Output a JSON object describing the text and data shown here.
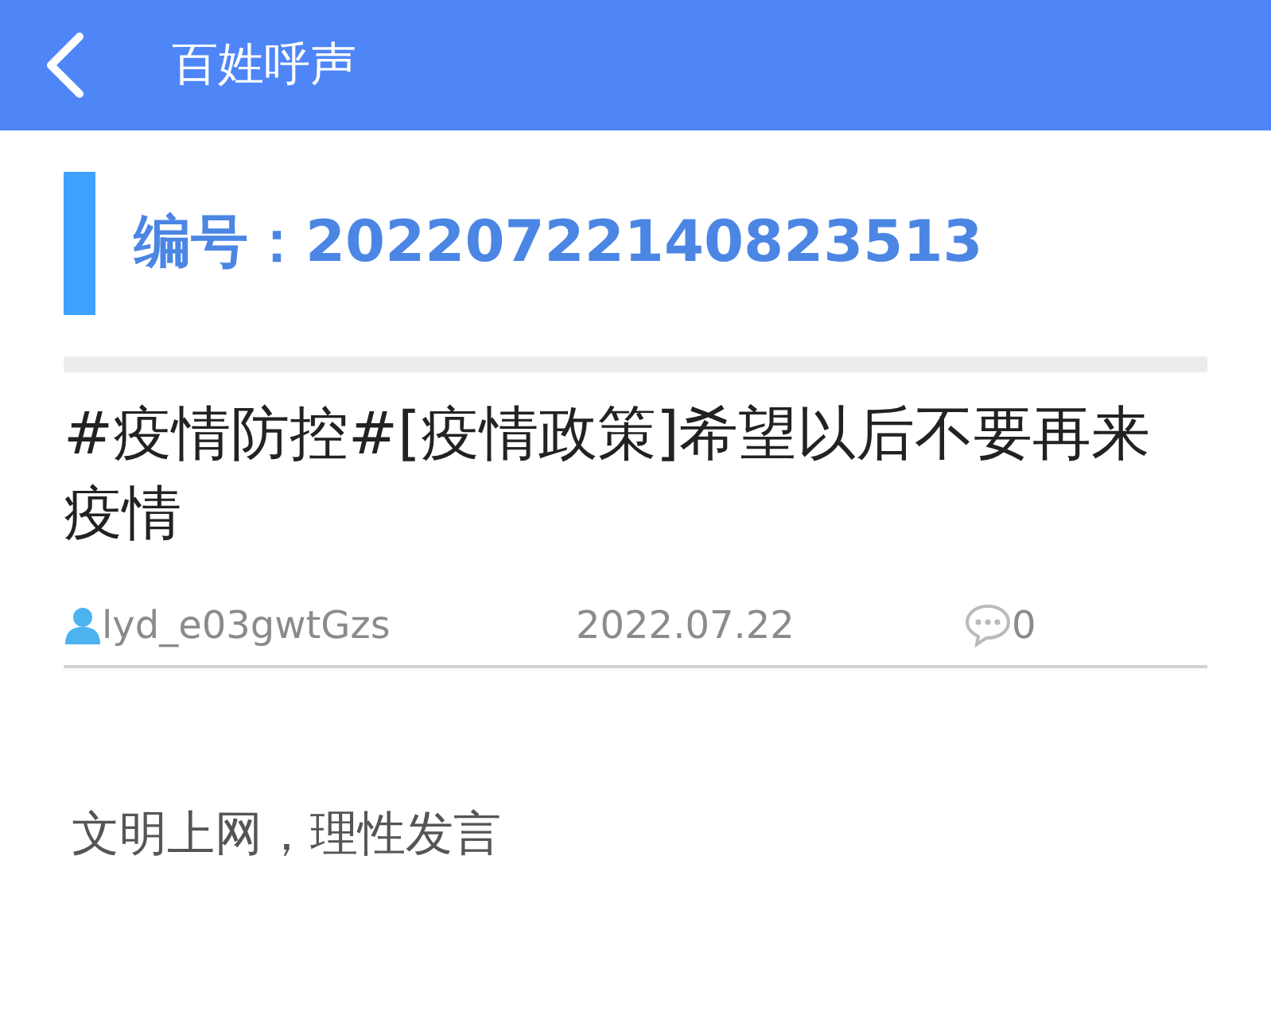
{
  "header": {
    "title": "百姓呼声"
  },
  "post": {
    "number": "编号：20220722140823513",
    "title": "#疫情防控#[疫情政策]希望以后不要再来疫情",
    "author": "lyd_e03gwtGzs",
    "date": "2022.07.22",
    "comments": "0"
  },
  "footer_note": "文明上网，理性发言"
}
